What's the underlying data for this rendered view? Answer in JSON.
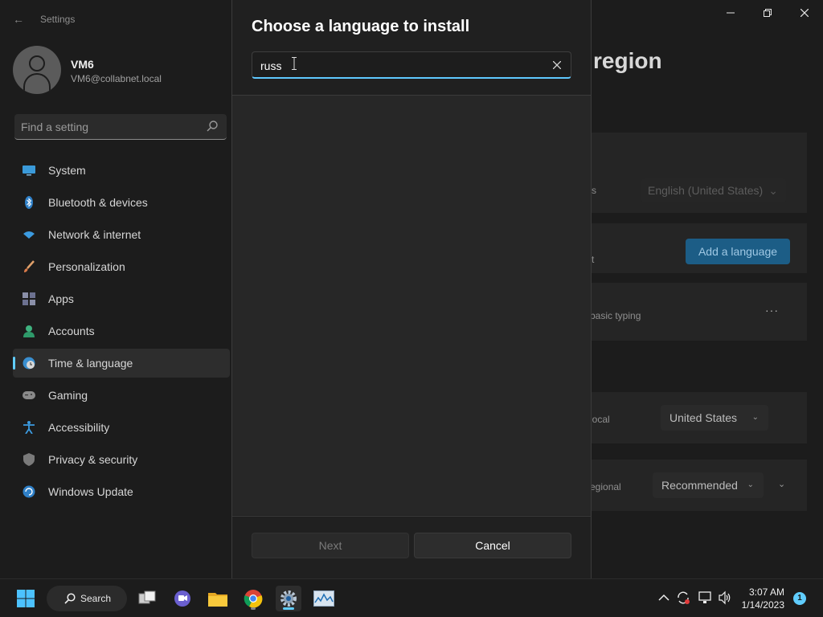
{
  "window": {
    "app_title": "Settings",
    "back_glyph": "←",
    "minimize_glyph": "—",
    "maximize_glyph": "❐",
    "close_glyph": "✕"
  },
  "profile": {
    "name": "VM6",
    "email": "VM6@collabnet.local"
  },
  "sidebar": {
    "search_placeholder": "Find a setting",
    "items": [
      {
        "label": "System",
        "icon": "system-icon"
      },
      {
        "label": "Bluetooth & devices",
        "icon": "bluetooth-icon"
      },
      {
        "label": "Network & internet",
        "icon": "network-icon"
      },
      {
        "label": "Personalization",
        "icon": "brush-icon"
      },
      {
        "label": "Apps",
        "icon": "apps-icon"
      },
      {
        "label": "Accounts",
        "icon": "accounts-icon"
      },
      {
        "label": "Time & language",
        "icon": "globe-clock-icon",
        "active": true
      },
      {
        "label": "Gaming",
        "icon": "gamepad-icon"
      },
      {
        "label": "Accessibility",
        "icon": "accessibility-icon"
      },
      {
        "label": "Privacy & security",
        "icon": "shield-icon"
      },
      {
        "label": "Windows Update",
        "icon": "update-icon"
      }
    ]
  },
  "main": {
    "page_title_partial": "region",
    "display_language_row_partial": "s",
    "display_language_value": "English (United States)",
    "preferred_languages_row_partial": "t",
    "add_language_label": "Add a language",
    "typing_text_partial": "basic typing",
    "more_glyph": "···",
    "country_row_partial": "local",
    "country_value": "United States",
    "regional_format_row_partial": "egional",
    "regional_format_value": "Recommended",
    "chevron_glyph": "⌄"
  },
  "dialog": {
    "title": "Choose a language to install",
    "search_value": "russ",
    "clear_glyph": "✕",
    "next_label": "Next",
    "cancel_label": "Cancel"
  },
  "taskbar": {
    "search_label": "Search",
    "apps": [
      "start-icon",
      "task-view-icon",
      "teams-chat-icon",
      "file-explorer-icon",
      "chrome-icon",
      "settings-icon",
      "resource-monitor-icon"
    ],
    "tray_chevron": "^",
    "time": "3:07 AM",
    "date": "1/14/2023",
    "notification_count": "1",
    "colors": {
      "accent": "#60cdff",
      "taskbar_bg": "#1c1c1c"
    }
  }
}
